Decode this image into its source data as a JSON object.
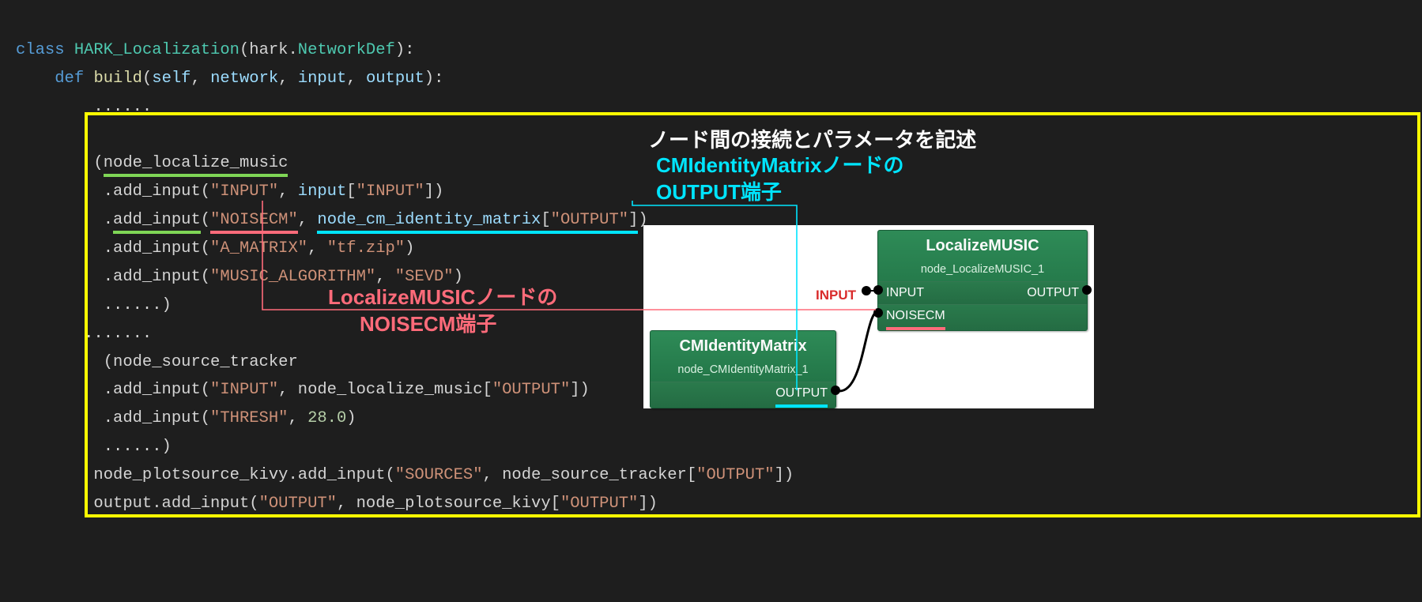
{
  "code": {
    "l1a": "class",
    "l1b": "HARK_Localization",
    "l1c": "(hark.",
    "l1d": "NetworkDef",
    "l1e": "):",
    "l2a": "def",
    "l2b": "build",
    "l2c": "(",
    "l2d": "self",
    "l2e": ", ",
    "l2f": "network",
    "l2g": ", ",
    "l2h": "input",
    "l2i": ", ",
    "l2j": "output",
    "l2k": "):",
    "l3": "......",
    "l5a": "(",
    "l5b": "node_localize_music",
    "l6a": " .add_input(",
    "l6b": "\"INPUT\"",
    "l6c": ", ",
    "l6d": "input",
    "l6e": "[",
    "l6f": "\"INPUT\"",
    "l6g": "])",
    "l7a": " .",
    "l7b": "add_input",
    "l7c": "(",
    "l7d": "\"NOISECM\"",
    "l7e": ", ",
    "l7f": "node_cm_identity_matrix[\"OUTPUT\"]",
    "l7g": ")",
    "l8a": " .add_input(",
    "l8b": "\"A_MATRIX\"",
    "l8c": ", ",
    "l8d": "\"tf.zip\"",
    "l8e": ")",
    "l9a": " .add_input(",
    "l9b": "\"MUSIC_ALGORITHM\"",
    "l9c": ", ",
    "l9d": "\"SEVD\"",
    "l9e": ")",
    "l10": " ......)",
    "l11": ".......",
    "l12a": " (node_source_tracker",
    "l13a": " .add_input(",
    "l13b": "\"INPUT\"",
    "l13c": ", node_localize_music[",
    "l13d": "\"OUTPUT\"",
    "l13e": "])",
    "l14a": " .add_input(",
    "l14b": "\"THRESH\"",
    "l14c": ", ",
    "l14d": "28.0",
    "l14e": ")",
    "l15": " ......)",
    "l16a": "node_plotsource_kivy.add_input(",
    "l16b": "\"SOURCES\"",
    "l16c": ", node_source_tracker[",
    "l16d": "\"OUTPUT\"",
    "l16e": "])",
    "l17a": "output.add_input(",
    "l17b": "\"OUTPUT\"",
    "l17c": ", node_plotsource_kivy[",
    "l17d": "\"OUTPUT\"",
    "l17e": "])"
  },
  "annotations": {
    "title": "ノード間の接続とパラメータを記述",
    "cyan1": "CMIdentityMatrixノードの",
    "cyan2": "OUTPUT端子",
    "pink1": "LocalizeMUSICノードの",
    "pink2": "NOISECM端子"
  },
  "graph": {
    "input_label": "INPUT",
    "node1": {
      "title": "LocalizeMUSIC",
      "sub": "node_LocalizeMUSIC_1",
      "port_in1": "INPUT",
      "port_in2": "NOISECM",
      "port_out": "OUTPUT"
    },
    "node2": {
      "title": "CMIdentityMatrix",
      "sub": "node_CMIdentityMatrix_1",
      "port_out": "OUTPUT"
    }
  }
}
